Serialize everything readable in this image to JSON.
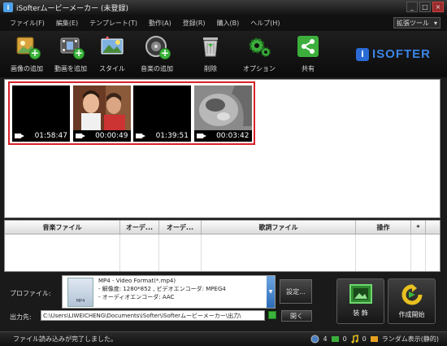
{
  "window": {
    "title": "iSofterムービーメーカー (未登録)"
  },
  "menu": {
    "items": [
      "ファイル(F)",
      "編集(E)",
      "テンプレート(T)",
      "動作(A)",
      "登録(R)",
      "購入(B)",
      "ヘルプ(H)"
    ],
    "ext_tools": "拡張ツール"
  },
  "toolbar": {
    "add_image": "画像の追加",
    "add_video": "動画を追加",
    "style": "スタイル",
    "add_music": "音楽の追加",
    "delete": "削除",
    "options": "オプション",
    "share": "共有"
  },
  "logo": {
    "text": "ISOFTER"
  },
  "clips": [
    {
      "duration": "01:58:47",
      "thumb": "black"
    },
    {
      "duration": "00:00:49",
      "thumb": "couple"
    },
    {
      "duration": "01:39:51",
      "thumb": "black"
    },
    {
      "duration": "00:03:42",
      "thumb": "gray"
    }
  ],
  "music_table": {
    "columns": [
      "音楽ファイル",
      "オーデ...",
      "オーデ...",
      "歌詞ファイル",
      "操作",
      "*"
    ]
  },
  "profile": {
    "label": "プロファイル:",
    "format": "MP4 - Video Format(*.mp4)",
    "resolution": "- 解像度: 1280*852 , ビデオエンコーダ: MPEG4",
    "audio": "- オーディオエンコーダ: AAC",
    "icon_text": "MP4",
    "settings_label": "設定..."
  },
  "output": {
    "label": "出力先:",
    "path": "C:\\Users\\LIWEICHENG\\Documents\\iSofter\\iSofterムービーメーカー\\出力\\",
    "open_label": "開く"
  },
  "actions": {
    "decorate": "装 飾",
    "start": "作成開始"
  },
  "status": {
    "message": "ファイル読み込みが完了しました。",
    "count_a": "4",
    "count_b": "0",
    "count_c": "0",
    "random": "ランダム表示(静的)"
  }
}
